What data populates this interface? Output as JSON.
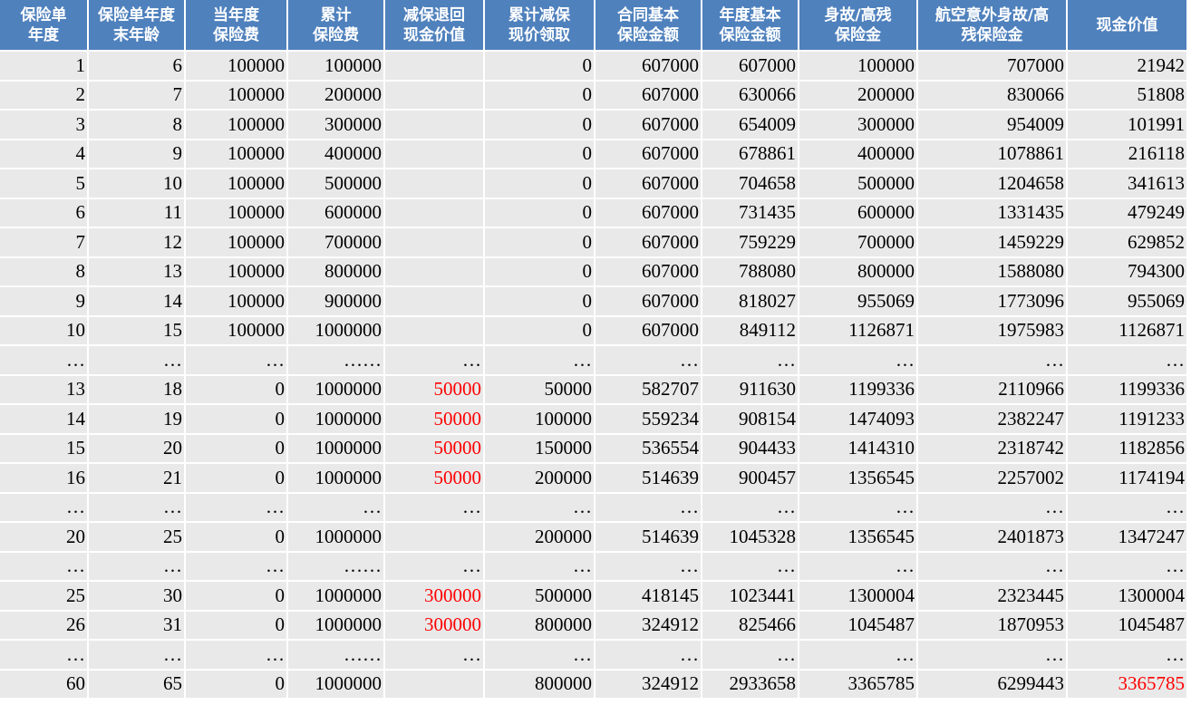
{
  "table": {
    "headers": [
      "保险单\n年度",
      "保险单年度\n末年龄",
      "当年度\n保险费",
      "累计\n保险费",
      "减保退回\n现金价值",
      "累计减保\n现价领取",
      "合同基本\n保险金额",
      "年度基本\n保险金额",
      "身故/高残\n保险金",
      "航空意外身故/高\n残保险金",
      "现金价值"
    ],
    "rows": [
      [
        "1",
        "6",
        "100000",
        "100000",
        "",
        "0",
        "607000",
        "607000",
        "100000",
        "707000",
        "21942"
      ],
      [
        "2",
        "7",
        "100000",
        "200000",
        "",
        "0",
        "607000",
        "630066",
        "200000",
        "830066",
        "51808"
      ],
      [
        "3",
        "8",
        "100000",
        "300000",
        "",
        "0",
        "607000",
        "654009",
        "300000",
        "954009",
        "101991"
      ],
      [
        "4",
        "9",
        "100000",
        "400000",
        "",
        "0",
        "607000",
        "678861",
        "400000",
        "1078861",
        "216118"
      ],
      [
        "5",
        "10",
        "100000",
        "500000",
        "",
        "0",
        "607000",
        "704658",
        "500000",
        "1204658",
        "341613"
      ],
      [
        "6",
        "11",
        "100000",
        "600000",
        "",
        "0",
        "607000",
        "731435",
        "600000",
        "1331435",
        "479249"
      ],
      [
        "7",
        "12",
        "100000",
        "700000",
        "",
        "0",
        "607000",
        "759229",
        "700000",
        "1459229",
        "629852"
      ],
      [
        "8",
        "13",
        "100000",
        "800000",
        "",
        "0",
        "607000",
        "788080",
        "800000",
        "1588080",
        "794300"
      ],
      [
        "9",
        "14",
        "100000",
        "900000",
        "",
        "0",
        "607000",
        "818027",
        "955069",
        "1773096",
        "955069"
      ],
      [
        "10",
        "15",
        "100000",
        "1000000",
        "",
        "0",
        "607000",
        "849112",
        "1126871",
        "1975983",
        "1126871"
      ],
      [
        "…",
        "…",
        "…",
        "……",
        "…",
        "…",
        "…",
        "…",
        "…",
        "…",
        "…"
      ],
      [
        "13",
        "18",
        "0",
        "1000000",
        "50000",
        "50000",
        "582707",
        "911630",
        "1199336",
        "2110966",
        "1199336"
      ],
      [
        "14",
        "19",
        "0",
        "1000000",
        "50000",
        "100000",
        "559234",
        "908154",
        "1474093",
        "2382247",
        "1191233"
      ],
      [
        "15",
        "20",
        "0",
        "1000000",
        "50000",
        "150000",
        "536554",
        "904433",
        "1414310",
        "2318742",
        "1182856"
      ],
      [
        "16",
        "21",
        "0",
        "1000000",
        "50000",
        "200000",
        "514639",
        "900457",
        "1356545",
        "2257002",
        "1174194"
      ],
      [
        "…",
        "…",
        "…",
        "…",
        "…",
        "…",
        "…",
        "…",
        "…",
        "…",
        "…"
      ],
      [
        "20",
        "25",
        "0",
        "1000000",
        "",
        "200000",
        "514639",
        "1045328",
        "1356545",
        "2401873",
        "1347247"
      ],
      [
        "…",
        "…",
        "…",
        "……",
        "…",
        "…",
        "…",
        "…",
        "…",
        "…",
        "…"
      ],
      [
        "25",
        "30",
        "0",
        "1000000",
        "300000",
        "500000",
        "418145",
        "1023441",
        "1300004",
        "2323445",
        "1300004"
      ],
      [
        "26",
        "31",
        "0",
        "1000000",
        "300000",
        "800000",
        "324912",
        "825466",
        "1045487",
        "1870953",
        "1045487"
      ],
      [
        "…",
        "…",
        "…",
        "……",
        "…",
        "…",
        "…",
        "…",
        "…",
        "…",
        "…"
      ],
      [
        "60",
        "65",
        "0",
        "1000000",
        "",
        "800000",
        "324912",
        "2933658",
        "3365785",
        "6299443",
        "3365785"
      ]
    ],
    "highlight_color": "#ff0000",
    "highlighted_cells": [
      [
        11,
        4
      ],
      [
        12,
        4
      ],
      [
        13,
        4
      ],
      [
        14,
        4
      ],
      [
        18,
        4
      ],
      [
        19,
        4
      ],
      [
        21,
        10
      ]
    ]
  }
}
